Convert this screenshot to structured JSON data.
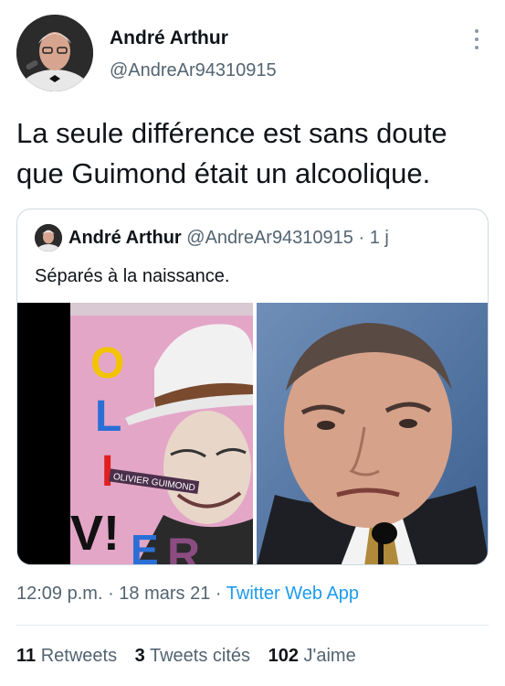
{
  "tweet": {
    "author_name": "André Arthur",
    "author_handle": "@AndreAr94310915",
    "text": "La seule différence est sans doute que Guimond était un alcoolique.",
    "more_icon": "more-vertical-icon"
  },
  "quoted": {
    "author_name": "André Arthur",
    "meta": "@AndreAr94310915 · 1 j",
    "text": "Séparés à la naissance.",
    "poster_letters": [
      "O",
      "L",
      "I",
      "V!",
      "E",
      "R"
    ],
    "poster_caption": "OLIVIER GUIMOND"
  },
  "footer": {
    "time": "12:09 p.m.",
    "sep1": " · ",
    "date": "18 mars 21",
    "sep2": " · ",
    "source": "Twitter Web App"
  },
  "stats": {
    "retweets_count": "11",
    "retweets_label": "Retweets",
    "quotes_count": "3",
    "quotes_label": "Tweets cités",
    "likes_count": "102",
    "likes_label": "J'aime"
  },
  "colors": {
    "accent": "#1d9bf0",
    "secondary_text": "#536471",
    "border": "#cfd9de"
  }
}
